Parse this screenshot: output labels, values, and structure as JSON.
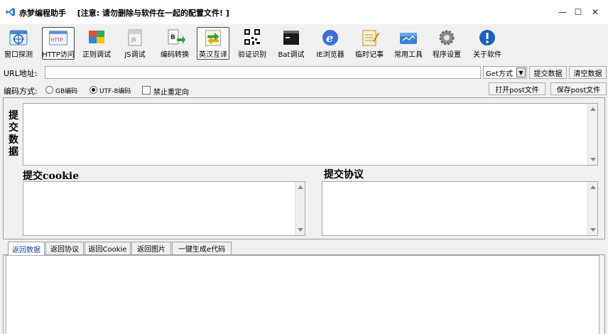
{
  "window": {
    "app_name": "赤梦编程助手",
    "notice": "[注意: 请勿删除与软件在一起的配置文件! ]",
    "controls": {
      "minimize": "—",
      "maximize": "☐",
      "close": "✕"
    }
  },
  "toolbar": {
    "items": [
      {
        "label": "窗口探测",
        "icon": "window-probe-icon"
      },
      {
        "label": "HTTP访问",
        "icon": "http-access-icon",
        "selected": true
      },
      {
        "label": "正则调试",
        "icon": "regex-debug-icon"
      },
      {
        "label": "JS调试",
        "icon": "js-debug-icon"
      },
      {
        "label": "编码转换",
        "icon": "encoding-convert-icon"
      },
      {
        "label": "英汉互译",
        "icon": "translate-icon"
      },
      {
        "label": "验证识别",
        "icon": "qr-code-icon"
      },
      {
        "label": "Bat调试",
        "icon": "bat-terminal-icon"
      },
      {
        "label": "IE浏览器",
        "icon": "ie-browser-icon"
      },
      {
        "label": "临时记事",
        "icon": "notepad-icon"
      },
      {
        "label": "常用工具",
        "icon": "toolbox-icon"
      },
      {
        "label": "程序设置",
        "icon": "settings-gear-icon"
      },
      {
        "label": "关于软件",
        "icon": "about-info-icon"
      }
    ]
  },
  "url_row": {
    "label": "URL地址:",
    "url_value": "",
    "method": "Get方式",
    "submit_label": "提交数据",
    "clear_label": "清空数据"
  },
  "encoding_row": {
    "label": "编码方式:",
    "gb_label": "GB编码",
    "utf8_label": "UTF-8编码",
    "selected": "UTF-8编码",
    "no_redirect_label": "禁止重定向",
    "no_redirect_checked": false,
    "open_post_label": "打开post文件",
    "save_post_label": "保存post文件"
  },
  "submit_panel": {
    "data_title": "提交数据",
    "data_value": "",
    "cookie_title": "提交cookie",
    "cookie_value": "",
    "protocol_title": "提交协议",
    "protocol_value": ""
  },
  "result_tabs": {
    "tabs": [
      "返回数据",
      "返回协议",
      "返回Cookie",
      "返回图片",
      "一键生成e代码"
    ],
    "active": "返回数据",
    "content": ""
  },
  "colors": {
    "window_bg": "#f0f0f0",
    "active_tab_text": "#1a3fa0",
    "logo_blue": "#2b7fd9"
  }
}
